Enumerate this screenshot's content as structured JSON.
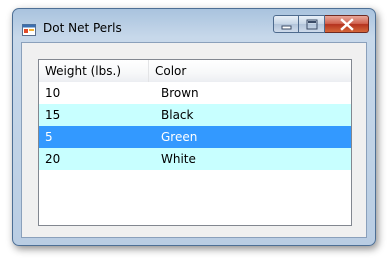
{
  "window": {
    "title": "Dot Net Perls"
  },
  "listview": {
    "columns": [
      "Weight (lbs.)",
      "Color"
    ],
    "rows": [
      {
        "weight": "10",
        "color": "Brown",
        "background": "#ffffff",
        "text_color": "#000000"
      },
      {
        "weight": "15",
        "color": "Black",
        "background": "#c8ffff",
        "text_color": "#000000"
      },
      {
        "weight": "5",
        "color": "Green",
        "background": "#3399ff",
        "text_color": "#ffffff"
      },
      {
        "weight": "20",
        "color": "White",
        "background": "#c8ffff",
        "text_color": "#000000"
      }
    ]
  },
  "icons": {
    "app": "application-icon",
    "minimize": "minimize-icon",
    "maximize": "maximize-icon",
    "close": "close-icon"
  }
}
